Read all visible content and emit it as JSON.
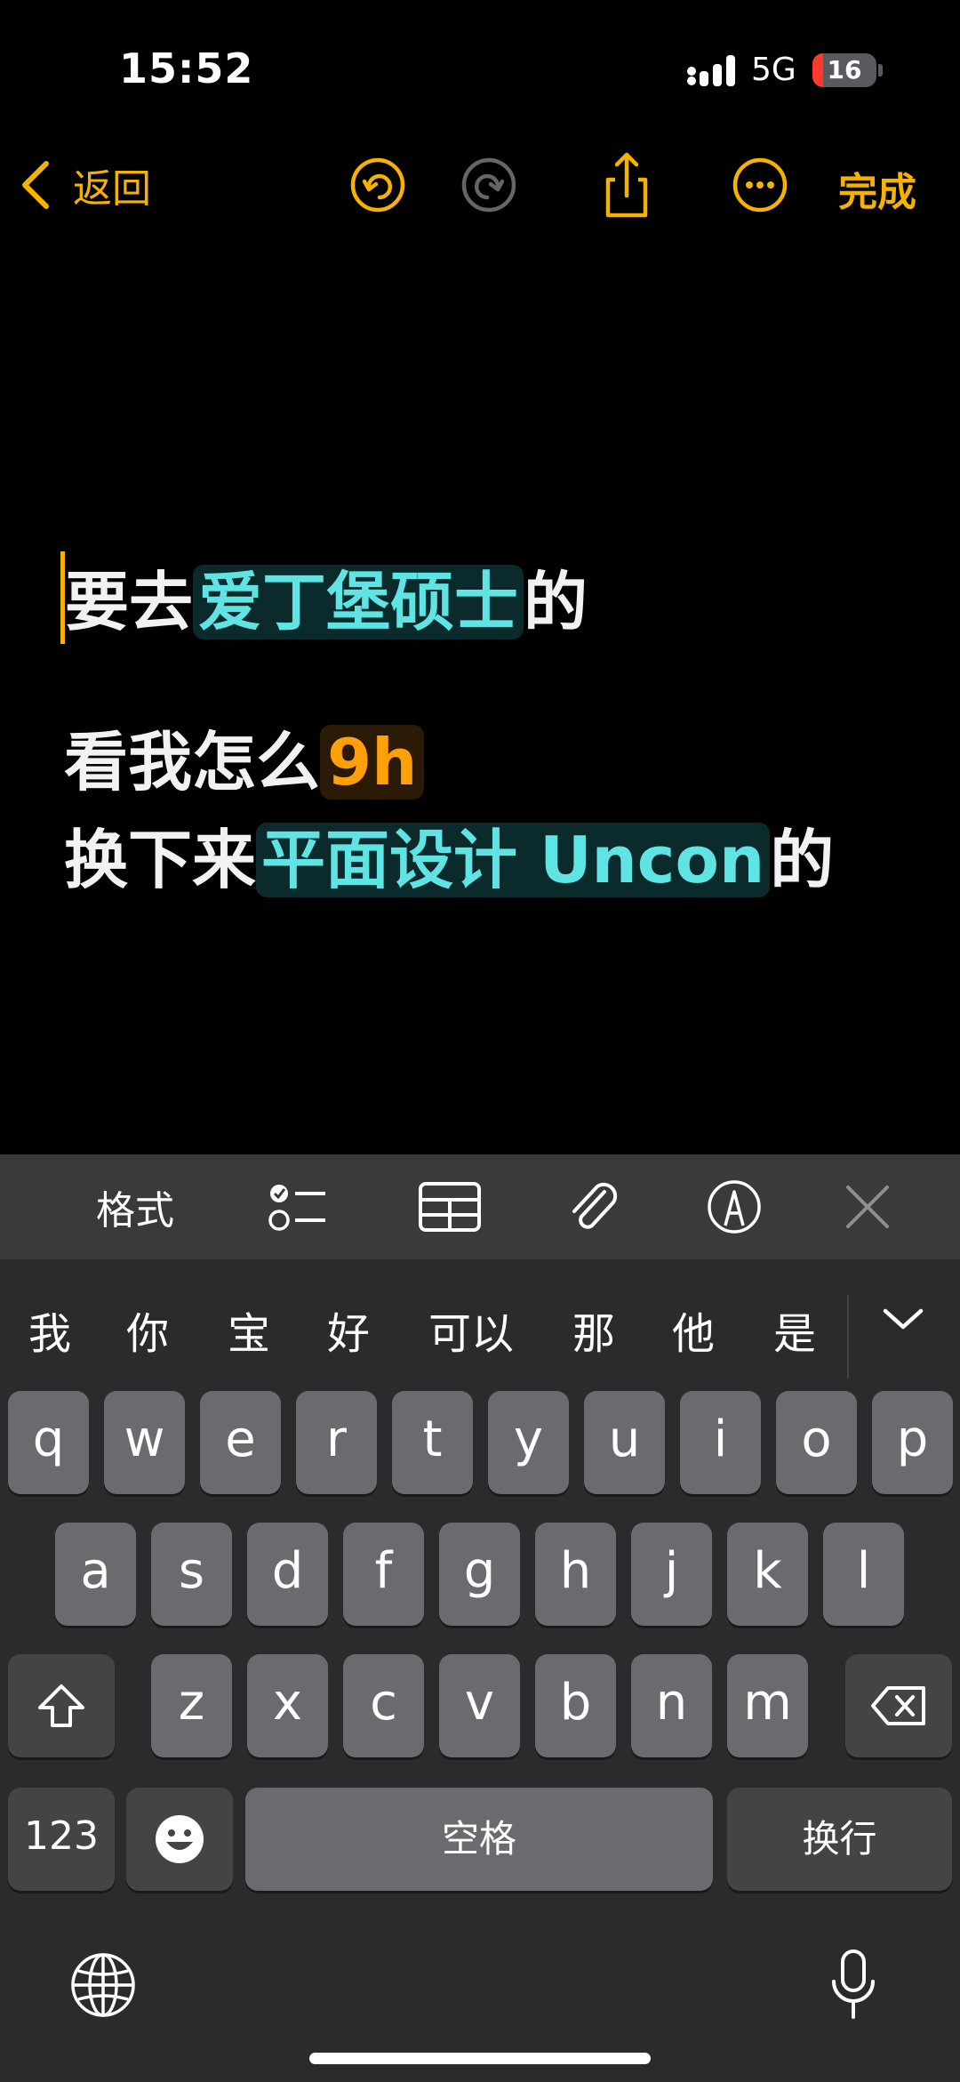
{
  "status_bar": {
    "time": "15:52",
    "network": "5G",
    "battery": "16",
    "battery_level": 0.16
  },
  "nav": {
    "back_label": "返回",
    "done_label": "完成"
  },
  "note": {
    "line1": {
      "before": "要去",
      "highlight": "爱丁堡硕士",
      "after": "的"
    },
    "line2": {
      "before": "看我怎么",
      "highlight": "9h"
    },
    "line3": {
      "before": "换下来",
      "highlight": "平面设计 Uncon",
      "after": "的"
    }
  },
  "toolbar": {
    "format_label": "格式"
  },
  "candidates": [
    "我",
    "你",
    "宝",
    "好",
    "可以",
    "那",
    "他",
    "是"
  ],
  "keyboard": {
    "row1": [
      "q",
      "w",
      "e",
      "r",
      "t",
      "y",
      "u",
      "i",
      "o",
      "p"
    ],
    "row2": [
      "a",
      "s",
      "d",
      "f",
      "g",
      "h",
      "j",
      "k",
      "l"
    ],
    "row3": [
      "z",
      "x",
      "c",
      "v",
      "b",
      "n",
      "m"
    ],
    "numbers_label": "123",
    "space_label": "空格",
    "return_label": "换行"
  },
  "colors": {
    "accent": "#f5b200",
    "highlight_cyan": "#5fe3e3",
    "highlight_orange": "#ff9f0a"
  }
}
